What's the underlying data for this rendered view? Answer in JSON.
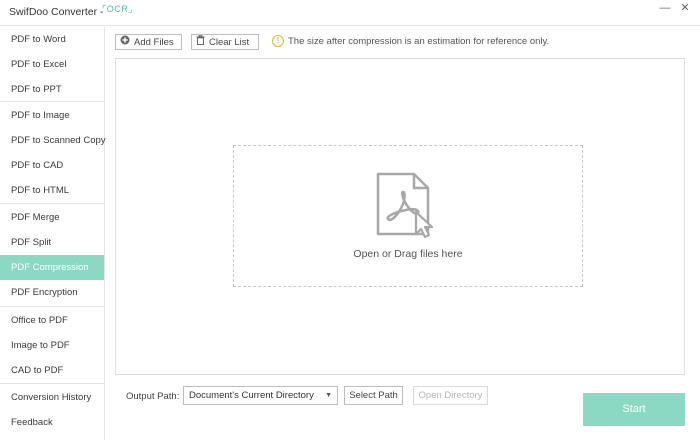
{
  "window": {
    "title": "SwifDoo Converter -",
    "ocr_badge": "OCR",
    "minimize_glyph": "—",
    "close_glyph": "✕"
  },
  "sidebar": {
    "items": [
      {
        "label": "PDF to Word"
      },
      {
        "label": "PDF to Excel"
      },
      {
        "label": "PDF to PPT"
      },
      {
        "label": "PDF to Image"
      },
      {
        "label": "PDF to Scanned Copy"
      },
      {
        "label": "PDF to CAD"
      },
      {
        "label": "PDF to HTML"
      },
      {
        "label": "PDF Merge"
      },
      {
        "label": "PDF Split"
      },
      {
        "label": "PDF Compression",
        "active": true
      },
      {
        "label": "PDF Encryption"
      },
      {
        "label": "Office to PDF"
      },
      {
        "label": "Image to PDF"
      },
      {
        "label": "CAD to PDF"
      },
      {
        "label": "Conversion History"
      },
      {
        "label": "Feedback"
      }
    ]
  },
  "toolbar": {
    "add_files": "Add Files",
    "clear_list": "Clear List",
    "note_icon": "!",
    "note": "The size after compression is an estimation for reference only."
  },
  "drop_zone": {
    "text": "Open or Drag files here",
    "icon": "pdf-file-icon"
  },
  "bottom": {
    "output_label": "Output Path:",
    "output_value": "Document's Current Directory",
    "select_path": "Select Path",
    "open_directory": "Open Directory",
    "start": "Start"
  },
  "colors": {
    "accent": "#8cd9c3",
    "ocr": "#4fc3a1",
    "warning": "#e6b422"
  }
}
